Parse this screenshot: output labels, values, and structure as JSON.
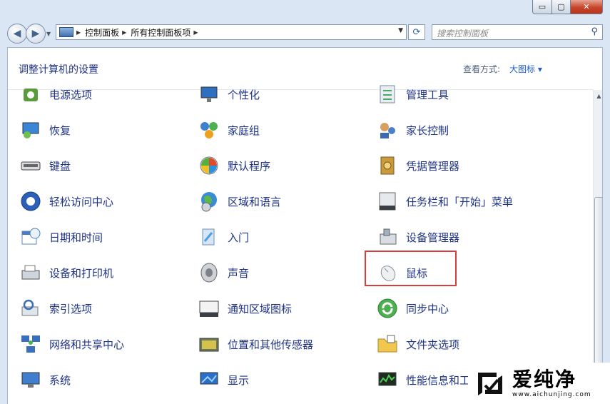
{
  "window": {
    "min_label": "▭",
    "max_label": "▢",
    "close_label": "✕"
  },
  "nav": {
    "back_label": "◀",
    "forward_label": "▶",
    "breadcrumb": [
      "控制面板",
      "所有控制面板项"
    ],
    "search_placeholder": "搜索控制面板"
  },
  "header": {
    "title": "调整计算机的设置",
    "view_label": "查看方式:",
    "view_value": "大图标 ▾"
  },
  "items": [
    {
      "label": "电源选项",
      "icon": "power-icon"
    },
    {
      "label": "个性化",
      "icon": "personalization-icon"
    },
    {
      "label": "管理工具",
      "icon": "admin-tools-icon"
    },
    {
      "label": "恢复",
      "icon": "recovery-icon"
    },
    {
      "label": "家庭组",
      "icon": "homegroup-icon"
    },
    {
      "label": "家长控制",
      "icon": "parental-controls-icon"
    },
    {
      "label": "键盘",
      "icon": "keyboard-icon"
    },
    {
      "label": "默认程序",
      "icon": "default-programs-icon"
    },
    {
      "label": "凭据管理器",
      "icon": "credential-manager-icon"
    },
    {
      "label": "轻松访问中心",
      "icon": "ease-of-access-icon"
    },
    {
      "label": "区域和语言",
      "icon": "region-language-icon"
    },
    {
      "label": "任务栏和「开始」菜单",
      "icon": "taskbar-start-icon"
    },
    {
      "label": "日期和时间",
      "icon": "date-time-icon"
    },
    {
      "label": "入门",
      "icon": "getting-started-icon"
    },
    {
      "label": "设备管理器",
      "icon": "device-manager-icon"
    },
    {
      "label": "设备和打印机",
      "icon": "devices-printers-icon"
    },
    {
      "label": "声音",
      "icon": "sound-icon"
    },
    {
      "label": "鼠标",
      "icon": "mouse-icon"
    },
    {
      "label": "索引选项",
      "icon": "indexing-icon"
    },
    {
      "label": "通知区域图标",
      "icon": "notification-area-icon"
    },
    {
      "label": "同步中心",
      "icon": "sync-center-icon"
    },
    {
      "label": "网络和共享中心",
      "icon": "network-sharing-icon"
    },
    {
      "label": "位置和其他传感器",
      "icon": "location-sensors-icon"
    },
    {
      "label": "文件夹选项",
      "icon": "folder-options-icon"
    },
    {
      "label": "系统",
      "icon": "system-icon"
    },
    {
      "label": "显示",
      "icon": "display-icon"
    },
    {
      "label": "性能信息和工具",
      "icon": "performance-icon"
    }
  ],
  "watermark": {
    "name": "爱纯净",
    "url": "www.aichunjing.com"
  }
}
